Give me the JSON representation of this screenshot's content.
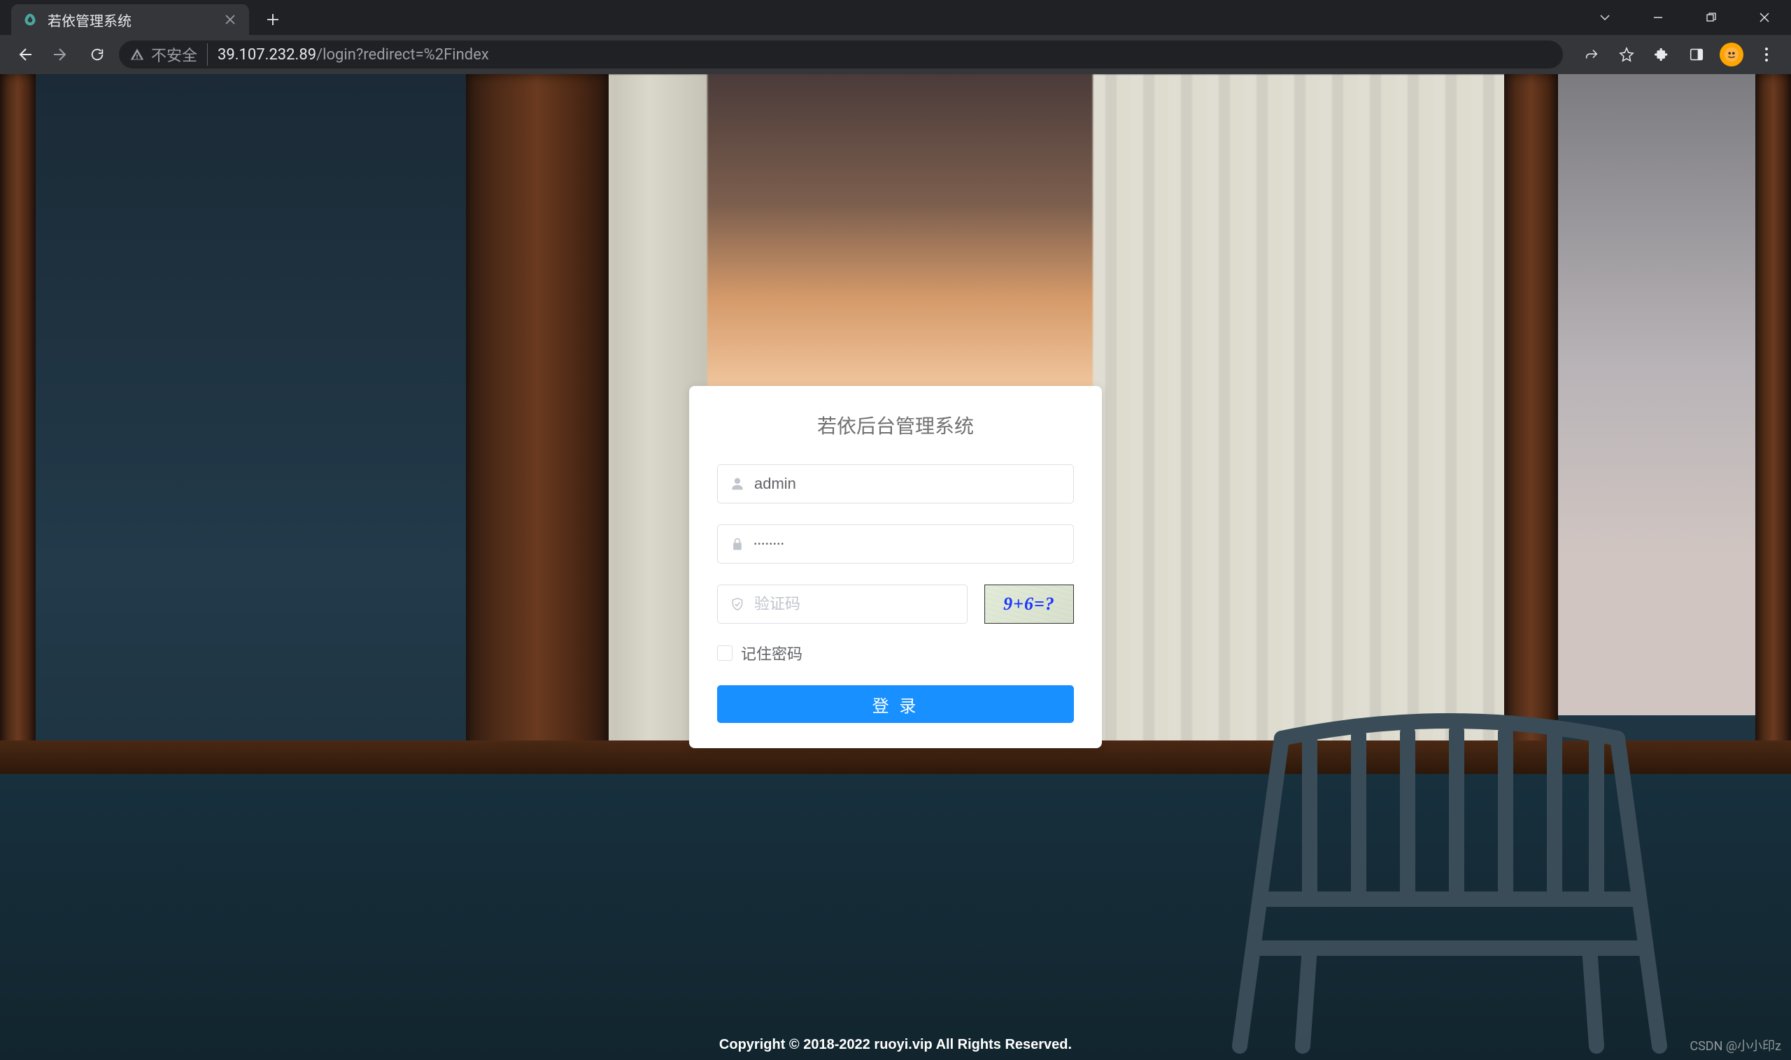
{
  "browser": {
    "tab": {
      "title": "若依管理系统"
    },
    "security_label": "不安全",
    "url_host": "39.107.232.89",
    "url_path": "/login?redirect=%2Findex"
  },
  "login": {
    "title": "若依后台管理系统",
    "username_value": "admin",
    "password_value": "••••••••",
    "captcha_placeholder": "验证码",
    "captcha_text": "9+6=?",
    "remember_label": "记住密码",
    "submit_label": "登 录"
  },
  "footer": {
    "copyright": "Copyright © 2018-2022 ruoyi.vip All Rights Reserved."
  },
  "watermark": "CSDN @小小印z"
}
